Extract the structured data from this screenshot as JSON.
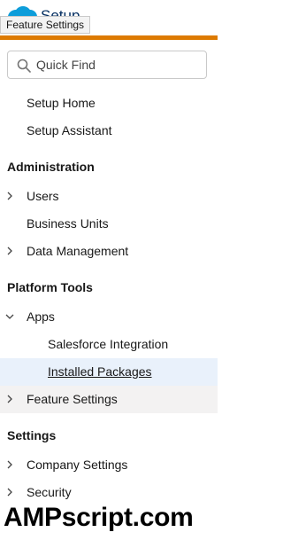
{
  "header": {
    "app_title": "Setup",
    "tooltip": "Feature Settings",
    "accent_color": "#dd7a01"
  },
  "search": {
    "placeholder": "Quick Find",
    "icon": "search-icon"
  },
  "nav": {
    "setup_home": "Setup Home",
    "setup_assistant": "Setup Assistant",
    "section_administration": "Administration",
    "users": "Users",
    "business_units": "Business Units",
    "data_management": "Data Management",
    "section_platform_tools": "Platform Tools",
    "apps": "Apps",
    "salesforce_integration": "Salesforce Integration",
    "installed_packages": "Installed Packages",
    "feature_settings": "Feature Settings",
    "section_settings": "Settings",
    "company_settings": "Company Settings",
    "security": "Security"
  },
  "watermark": "AMPscript.com"
}
